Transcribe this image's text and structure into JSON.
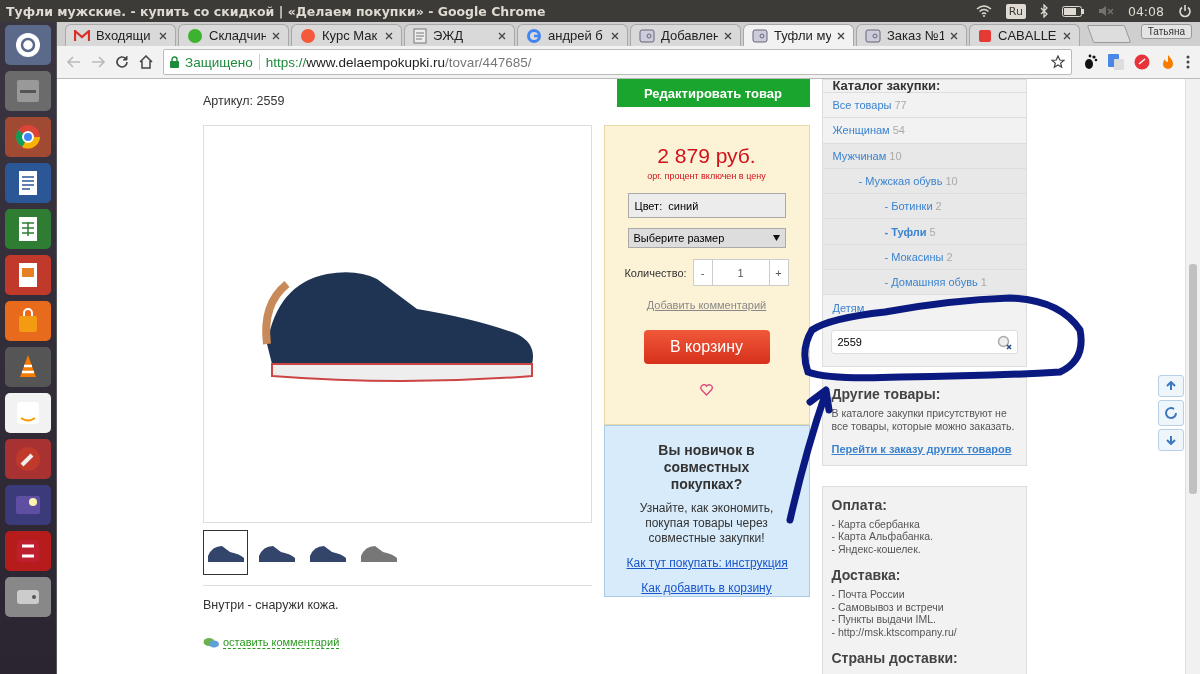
{
  "top_bar": {
    "window_title": "Туфли мужские. - купить со скидкой | «Делаем покупки» - Google Chrome",
    "keyboard_layout": "Ru",
    "time": "04:08"
  },
  "browser": {
    "tabs": [
      {
        "label": "Входящи",
        "kind": "mail",
        "selected": false
      },
      {
        "label": "Складчин",
        "kind": "circle-s",
        "selected": false
      },
      {
        "label": "Курс Мак",
        "kind": "dot",
        "selected": false
      },
      {
        "label": "ЭЖД",
        "kind": "document",
        "selected": false
      },
      {
        "label": "андрей б",
        "kind": "ring",
        "selected": false
      },
      {
        "label": "Добавлен",
        "kind": "site",
        "selected": false
      },
      {
        "label": "Туфли му",
        "kind": "site",
        "selected": true
      },
      {
        "label": "Заказ №1",
        "kind": "site",
        "selected": false
      },
      {
        "label": "CABALLE",
        "kind": "square",
        "selected": false
      }
    ],
    "profile": "Татьяна",
    "address": {
      "secure_label": "Защищено",
      "scheme": "https://",
      "host": "www.delaempokupki.ru",
      "path": "/tovar/447685/"
    }
  },
  "product": {
    "article": "Артикул: 2559",
    "thumbnails": [
      {
        "selected": true
      },
      {
        "selected": false
      },
      {
        "selected": false
      },
      {
        "selected": false
      }
    ],
    "description": "Внутри - снаружи кожа.",
    "comment_link": "оставить комментарий"
  },
  "buy_box": {
    "edit_button": "Редактировать товар",
    "price": "2 879 руб.",
    "price_note": "орг. процент включен в цену",
    "color_field": "Цвет:  синий",
    "size_placeholder": "Выберите размер",
    "quantity_label": "Количество:",
    "minus": "-",
    "quantity": "1",
    "plus": "+",
    "comment_link": "Добавить комментарий",
    "cart_button": "В корзину"
  },
  "help_box": {
    "title": "Вы новичок в совместных покупках?",
    "text": "Узнайте, как экономить, покупая товары через совместные закупки!",
    "links": [
      "Как тут покупать: инструкция",
      "Как добавить в корзину"
    ]
  },
  "catalog": {
    "title": "Каталог закупки:",
    "items": [
      {
        "label": "Все товары",
        "count": "77",
        "selected": false
      },
      {
        "label": "Женщинам",
        "count": "54",
        "selected": false
      },
      {
        "label": "Мужчинам",
        "count": "10",
        "selected": false,
        "children": [
          {
            "label": "- Мужская обувь",
            "count": "10",
            "selected": false,
            "children": [
              {
                "label": "- Ботинки",
                "count": "2",
                "selected": false
              },
              {
                "label": "- Туфли",
                "count": "5",
                "selected": true
              },
              {
                "label": "- Мокасины",
                "count": "2",
                "selected": false
              },
              {
                "label": "- Домашняя обувь",
                "count": "1",
                "selected": false
              }
            ]
          }
        ]
      },
      {
        "label": "Детям",
        "selected": false
      }
    ],
    "search": {
      "value": "2559"
    }
  },
  "other_goods": {
    "title": "Другие товары:",
    "text": "В каталоге закупки присутствуют не все товары, которые можно заказать.",
    "link": "Перейти к заказу других товаров"
  },
  "info": [
    {
      "title": "Оплата:",
      "items": [
        "- Карта сбербанка",
        "- Карта Альфабанка.",
        "- Яндекс-кошелек."
      ]
    },
    {
      "title": "Доставка:",
      "items": [
        "- Почта России",
        "- Самовывоз и встречи",
        "- Пункты выдачи IML.",
        "- http://msk.ktscompany.ru/"
      ]
    },
    {
      "title": "Страны доставки:"
    }
  ]
}
